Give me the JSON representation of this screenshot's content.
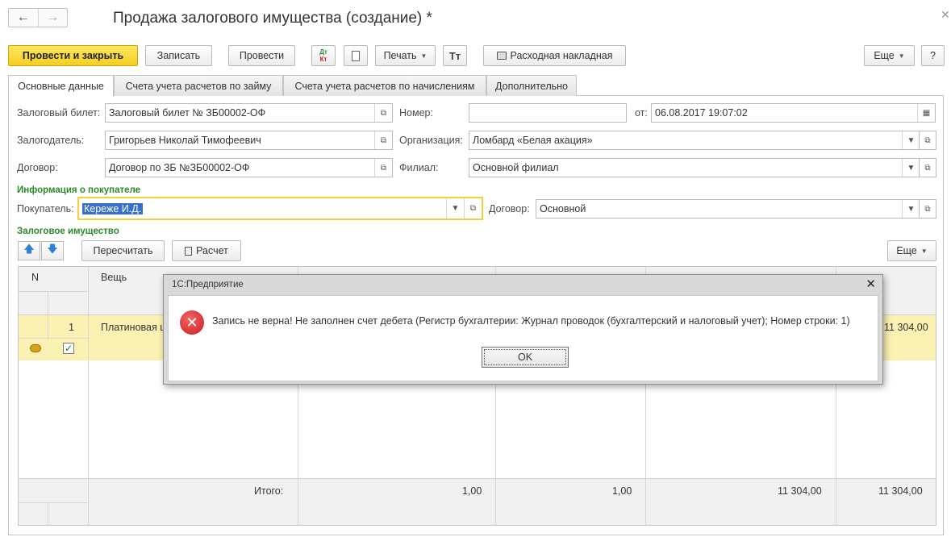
{
  "window": {
    "title": "Продажа залогового имущества (создание) *"
  },
  "toolbar": {
    "post_close": "Провести и закрыть",
    "save": "Записать",
    "post": "Провести",
    "dt_kt_dt": "Дт",
    "dt_kt_kt": "Кт",
    "print": "Печать",
    "invoice": "Расходная накладная",
    "more": "Еще",
    "help": "?"
  },
  "tabs": [
    "Основные данные",
    "Счета учета расчетов по займу",
    "Счета учета расчетов по начислениям",
    "Дополнительно"
  ],
  "form": {
    "pawn_ticket_label": "Залоговый билет:",
    "pawn_ticket_value": "Залоговый билет № ЗБ00002-ОФ",
    "number_label": "Номер:",
    "number_value": "",
    "date_label": "от:",
    "date_value": "06.08.2017 19:07:02",
    "pledger_label": "Залогодатель:",
    "pledger_value": "Григорьев Николай Тимофеевич",
    "org_label": "Организация:",
    "org_value": "Ломбард «Белая акация»",
    "contract_label": "Договор:",
    "contract_value": "Договор по ЗБ №ЗБ00002-ОФ",
    "branch_label": "Филиал:",
    "branch_value": "Основной филиал",
    "buyer_section": "Информация о покупателе",
    "buyer_label": "Покупатель:",
    "buyer_value": "Кереже И.Д.",
    "buyer_contract_label": "Договор:",
    "buyer_contract_value": "Основной",
    "property_section": "Залоговое имущество"
  },
  "grid_toolbar": {
    "recalc": "Пересчитать",
    "calc": "Расчет",
    "more": "Еще"
  },
  "grid": {
    "col_n": "N",
    "col_item": "Вещь",
    "row": {
      "n": "1",
      "item": "Платиновая ц",
      "last": "11 304,00"
    },
    "footer": {
      "label": "Итого:",
      "c1": "1,00",
      "c2": "1,00",
      "c3": "11 304,00",
      "c4": "11 304,00"
    }
  },
  "dialog": {
    "title": "1С:Предприятие",
    "message": "Запись не верна! Не заполнен счет дебета (Регистр бухгалтерии: Журнал проводок (бухгалтерский и налоговый учет); Номер строки: 1)",
    "ok": "OK"
  },
  "colors": {
    "primary": "#f5cf22",
    "section": "#2b8a2b",
    "selected_row": "#fbf1b2",
    "error": "#c81e1e"
  }
}
